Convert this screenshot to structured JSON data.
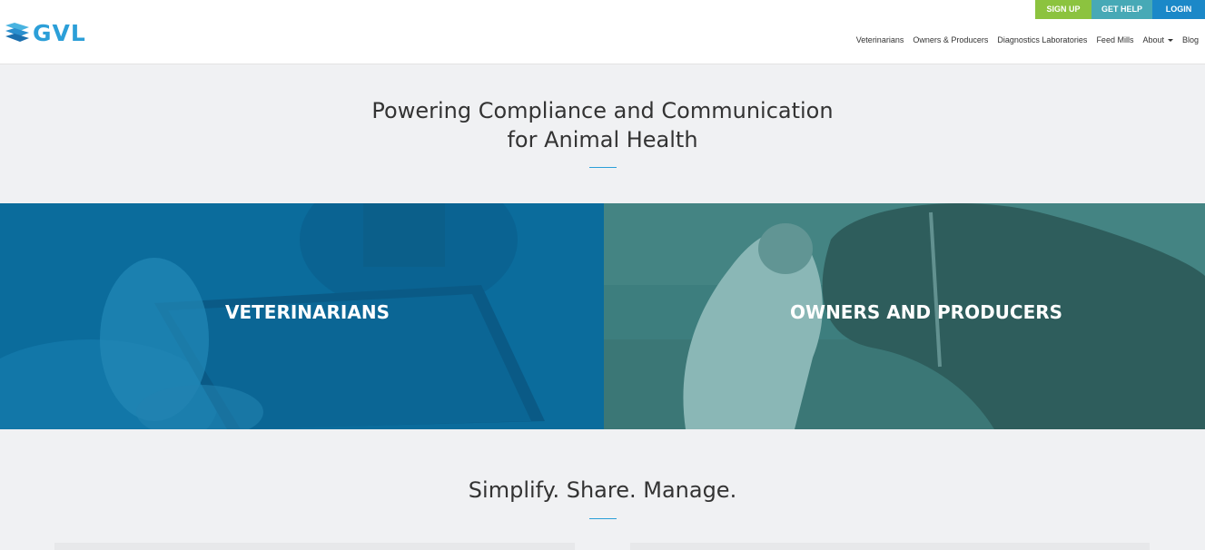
{
  "header": {
    "logo_text": "GVL",
    "auth": {
      "signup": "SIGN UP",
      "help": "GET HELP",
      "login": "LOGIN"
    },
    "nav": [
      "Veterinarians",
      "Owners & Producers",
      "Diagnostics Laboratories",
      "Feed Mills",
      "About",
      "Blog"
    ]
  },
  "hero": {
    "title_line1": "Powering Compliance and Communication",
    "title_line2": "for Animal Health"
  },
  "tiles": {
    "veterinarians": "VETERINARIANS",
    "owners": "OWNERS AND PRODUCERS"
  },
  "section2": {
    "title": "Simplify. Share. Manage."
  },
  "colors": {
    "accent": "#2c9fd8",
    "signup": "#8cc33f",
    "help": "#47a9b6",
    "login": "#1b88c8"
  },
  "icons": {
    "logo": "gvl-logo-icon",
    "about_dropdown": "chevron-down-icon"
  }
}
